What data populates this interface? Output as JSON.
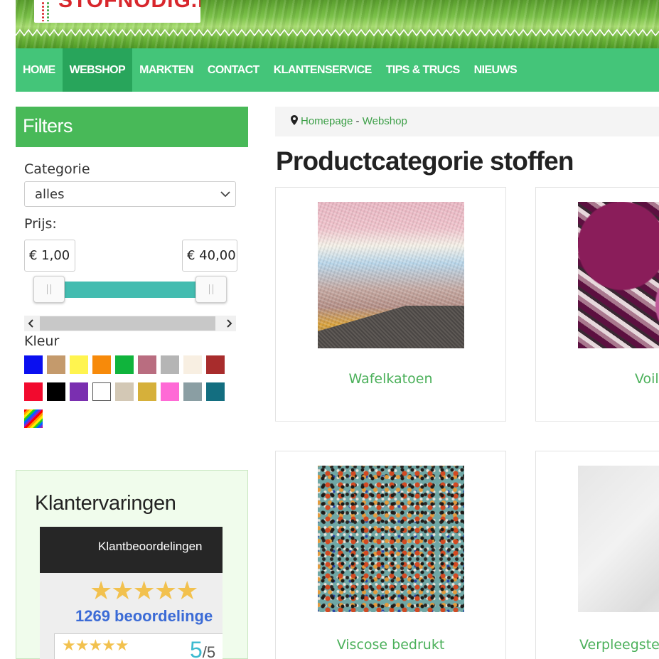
{
  "header": {
    "logo_text": "STOFNODIG.NL",
    "nav": [
      {
        "label": "HOME"
      },
      {
        "label": "WEBSHOP",
        "active": true
      },
      {
        "label": "MARKTEN"
      },
      {
        "label": "CONTACT"
      },
      {
        "label": "KLANTENSERVICE"
      },
      {
        "label": "TIPS & TRUCS"
      },
      {
        "label": "NIEUWS"
      }
    ]
  },
  "sidebar": {
    "filters_title": "Filters",
    "category_label": "Categorie",
    "category_value": "alles",
    "price_label": "Prijs:",
    "price_min": "€ 1,00",
    "price_max": "€ 40,00",
    "color_label": "Kleur",
    "colors": [
      "#0a0ff0",
      "#c49a6c",
      "#fff44f",
      "#f78a0a",
      "#10b43c",
      "#b96d80",
      "#b5b5b5",
      "#f8efe2",
      "#a82c2c",
      "#f20a2e",
      "#000000",
      "#7a2fb0",
      "#ffffff",
      "#d3c8b5",
      "#d6b03a",
      "#ff6ad6",
      "#8a9ea3",
      "#136e80",
      "rainbow"
    ]
  },
  "reviews": {
    "title": "Klantervaringen",
    "widget_header": "Klantbeoordelingen",
    "stars_big": "★★★★★",
    "count_text": "1269 beoordelinge",
    "stars_small": "★★★★★",
    "score": "5",
    "score_max": "/5"
  },
  "main": {
    "breadcrumb_home": "Homepage",
    "breadcrumb_sep": " - ",
    "breadcrumb_current": "Webshop",
    "title": "Productcategorie stoffen",
    "products": [
      {
        "name": "Wafelkatoen"
      },
      {
        "name": "Voil"
      },
      {
        "name": "Viscose bedrukt"
      },
      {
        "name": "Verpleegste"
      }
    ]
  },
  "colors": {
    "nav_bg": "#44c579",
    "nav_active": "#28a55b",
    "filters_bg": "#48b958",
    "link_green": "#4bb05a",
    "slider": "#43bcb0"
  }
}
